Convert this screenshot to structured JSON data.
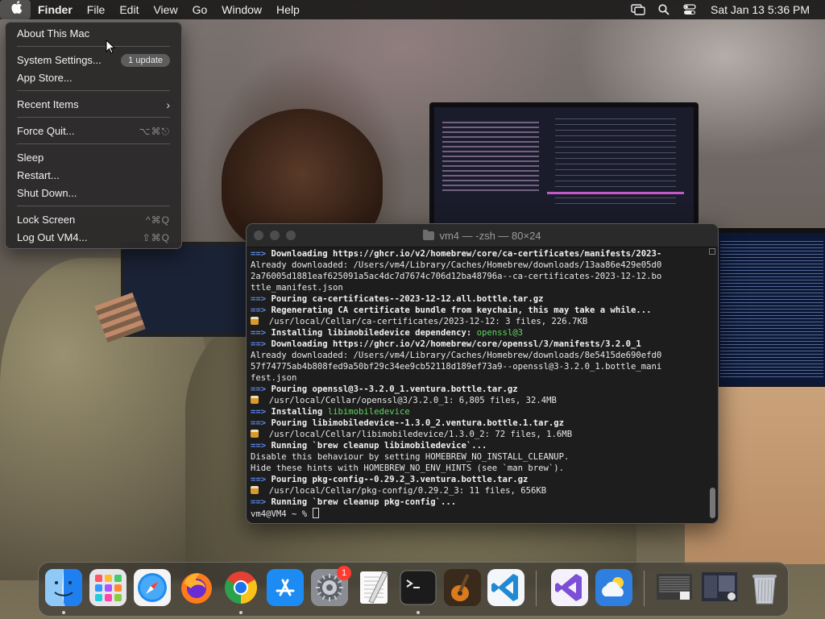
{
  "menubar": {
    "app_name": "Finder",
    "menus": [
      "File",
      "Edit",
      "View",
      "Go",
      "Window",
      "Help"
    ],
    "clock": "Sat Jan 13  5:36 PM",
    "status_icons": [
      "screen-mirroring-icon",
      "spotlight-icon",
      "control-center-icon"
    ]
  },
  "apple_menu": {
    "about": "About This Mac",
    "settings": "System Settings...",
    "settings_badge": "1 update",
    "app_store": "App Store...",
    "recent": "Recent Items",
    "force_quit": "Force Quit...",
    "force_quit_shortcut": "⌥⌘⎋",
    "sleep": "Sleep",
    "restart": "Restart...",
    "shutdown": "Shut Down...",
    "lock": "Lock Screen",
    "lock_shortcut": "^⌘Q",
    "logout": "Log Out VM4...",
    "logout_shortcut": "⇧⌘Q"
  },
  "terminal": {
    "title": "vm4 — -zsh — 80×24",
    "lines": [
      {
        "arrow": "==>",
        "bold": "Downloading https://ghcr.io/v2/homebrew/core/ca-certificates/manifests/2023-"
      },
      {
        "text": "Already downloaded: /Users/vm4/Library/Caches/Homebrew/downloads/13aa86e429e05d0"
      },
      {
        "text": "2a76005d1881eaf625091a5ac4dc7d7674c706d12ba48796a--ca-certificates-2023-12-12.bo"
      },
      {
        "text": "ttle_manifest.json"
      },
      {
        "arrow": "==>",
        "bold": "Pouring ca-certificates--2023-12-12.all.bottle.tar.gz"
      },
      {
        "arrow": "==>",
        "bold": "Regenerating CA certificate bundle from keychain, this may take a while..."
      },
      {
        "beer": true,
        "text": "/usr/local/Cellar/ca-certificates/2023-12-12: 3 files, 226.7KB"
      },
      {
        "arrow": "==>",
        "bold": "Installing libimobiledevice dependency: ",
        "green": "openssl@3"
      },
      {
        "arrow": "==>",
        "bold": "Downloading https://ghcr.io/v2/homebrew/core/openssl/3/manifests/3.2.0_1"
      },
      {
        "text": "Already downloaded: /Users/vm4/Library/Caches/Homebrew/downloads/8e5415de690efd0"
      },
      {
        "text": "57f74775ab4b808fed9a50bf29c34ee9cb52118d189ef73a9--openssl@3-3.2.0_1.bottle_mani"
      },
      {
        "text": "fest.json"
      },
      {
        "arrow": "==>",
        "bold": "Pouring openssl@3--3.2.0_1.ventura.bottle.tar.gz"
      },
      {
        "beer": true,
        "text": "/usr/local/Cellar/openssl@3/3.2.0_1: 6,805 files, 32.4MB"
      },
      {
        "arrow": "==>",
        "bold": "Installing ",
        "green": "libimobiledevice"
      },
      {
        "arrow": "==>",
        "bold": "Pouring libimobiledevice--1.3.0_2.ventura.bottle.1.tar.gz"
      },
      {
        "beer": true,
        "text": "/usr/local/Cellar/libimobiledevice/1.3.0_2: 72 files, 1.6MB"
      },
      {
        "arrow": "==>",
        "bold": "Running `brew cleanup libimobiledevice`..."
      },
      {
        "text": "Disable this behaviour by setting HOMEBREW_NO_INSTALL_CLEANUP."
      },
      {
        "text": "Hide these hints with HOMEBREW_NO_ENV_HINTS (see `man brew`)."
      },
      {
        "arrow": "==>",
        "bold": "Pouring pkg-config--0.29.2_3.ventura.bottle.tar.gz"
      },
      {
        "beer": true,
        "text": "/usr/local/Cellar/pkg-config/0.29.2_3: 11 files, 656KB"
      },
      {
        "arrow": "==>",
        "bold": "Running `brew cleanup pkg-config`..."
      }
    ],
    "prompt": "vm4@VM4 ~ % "
  },
  "dock": {
    "apps": [
      {
        "name": "finder",
        "running": true
      },
      {
        "name": "launchpad",
        "running": false
      },
      {
        "name": "safari",
        "running": false
      },
      {
        "name": "firefox",
        "running": false
      },
      {
        "name": "chrome",
        "running": true
      },
      {
        "name": "app-store",
        "running": false
      },
      {
        "name": "system-settings",
        "running": false,
        "badge": "1"
      },
      {
        "name": "textedit",
        "running": false
      },
      {
        "name": "terminal",
        "running": true
      },
      {
        "name": "garageband",
        "running": false
      },
      {
        "name": "vscode",
        "running": false
      },
      {
        "name": "visual-studio",
        "running": false
      },
      {
        "name": "weather",
        "running": false
      },
      {
        "name": "recent-window-1",
        "running": false
      },
      {
        "name": "recent-window-2",
        "running": false
      },
      {
        "name": "trash",
        "running": false
      }
    ],
    "accent_colors": {
      "badge": "#ff3b30",
      "link_arrow": "#5b86e6",
      "green": "#5fd75f"
    }
  }
}
